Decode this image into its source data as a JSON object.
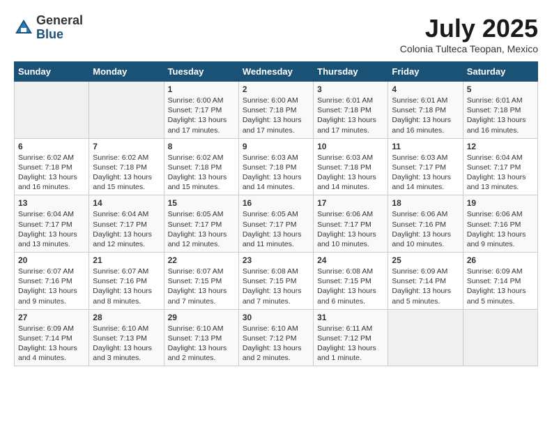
{
  "header": {
    "logo_general": "General",
    "logo_blue": "Blue",
    "month_title": "July 2025",
    "subtitle": "Colonia Tulteca Teopan, Mexico"
  },
  "days_of_week": [
    "Sunday",
    "Monday",
    "Tuesday",
    "Wednesday",
    "Thursday",
    "Friday",
    "Saturday"
  ],
  "weeks": [
    [
      {
        "day": "",
        "info": ""
      },
      {
        "day": "",
        "info": ""
      },
      {
        "day": "1",
        "info": "Sunrise: 6:00 AM\nSunset: 7:17 PM\nDaylight: 13 hours\nand 17 minutes."
      },
      {
        "day": "2",
        "info": "Sunrise: 6:00 AM\nSunset: 7:18 PM\nDaylight: 13 hours\nand 17 minutes."
      },
      {
        "day": "3",
        "info": "Sunrise: 6:01 AM\nSunset: 7:18 PM\nDaylight: 13 hours\nand 17 minutes."
      },
      {
        "day": "4",
        "info": "Sunrise: 6:01 AM\nSunset: 7:18 PM\nDaylight: 13 hours\nand 16 minutes."
      },
      {
        "day": "5",
        "info": "Sunrise: 6:01 AM\nSunset: 7:18 PM\nDaylight: 13 hours\nand 16 minutes."
      }
    ],
    [
      {
        "day": "6",
        "info": "Sunrise: 6:02 AM\nSunset: 7:18 PM\nDaylight: 13 hours\nand 16 minutes."
      },
      {
        "day": "7",
        "info": "Sunrise: 6:02 AM\nSunset: 7:18 PM\nDaylight: 13 hours\nand 15 minutes."
      },
      {
        "day": "8",
        "info": "Sunrise: 6:02 AM\nSunset: 7:18 PM\nDaylight: 13 hours\nand 15 minutes."
      },
      {
        "day": "9",
        "info": "Sunrise: 6:03 AM\nSunset: 7:18 PM\nDaylight: 13 hours\nand 14 minutes."
      },
      {
        "day": "10",
        "info": "Sunrise: 6:03 AM\nSunset: 7:18 PM\nDaylight: 13 hours\nand 14 minutes."
      },
      {
        "day": "11",
        "info": "Sunrise: 6:03 AM\nSunset: 7:17 PM\nDaylight: 13 hours\nand 14 minutes."
      },
      {
        "day": "12",
        "info": "Sunrise: 6:04 AM\nSunset: 7:17 PM\nDaylight: 13 hours\nand 13 minutes."
      }
    ],
    [
      {
        "day": "13",
        "info": "Sunrise: 6:04 AM\nSunset: 7:17 PM\nDaylight: 13 hours\nand 13 minutes."
      },
      {
        "day": "14",
        "info": "Sunrise: 6:04 AM\nSunset: 7:17 PM\nDaylight: 13 hours\nand 12 minutes."
      },
      {
        "day": "15",
        "info": "Sunrise: 6:05 AM\nSunset: 7:17 PM\nDaylight: 13 hours\nand 12 minutes."
      },
      {
        "day": "16",
        "info": "Sunrise: 6:05 AM\nSunset: 7:17 PM\nDaylight: 13 hours\nand 11 minutes."
      },
      {
        "day": "17",
        "info": "Sunrise: 6:06 AM\nSunset: 7:17 PM\nDaylight: 13 hours\nand 10 minutes."
      },
      {
        "day": "18",
        "info": "Sunrise: 6:06 AM\nSunset: 7:16 PM\nDaylight: 13 hours\nand 10 minutes."
      },
      {
        "day": "19",
        "info": "Sunrise: 6:06 AM\nSunset: 7:16 PM\nDaylight: 13 hours\nand 9 minutes."
      }
    ],
    [
      {
        "day": "20",
        "info": "Sunrise: 6:07 AM\nSunset: 7:16 PM\nDaylight: 13 hours\nand 9 minutes."
      },
      {
        "day": "21",
        "info": "Sunrise: 6:07 AM\nSunset: 7:16 PM\nDaylight: 13 hours\nand 8 minutes."
      },
      {
        "day": "22",
        "info": "Sunrise: 6:07 AM\nSunset: 7:15 PM\nDaylight: 13 hours\nand 7 minutes."
      },
      {
        "day": "23",
        "info": "Sunrise: 6:08 AM\nSunset: 7:15 PM\nDaylight: 13 hours\nand 7 minutes."
      },
      {
        "day": "24",
        "info": "Sunrise: 6:08 AM\nSunset: 7:15 PM\nDaylight: 13 hours\nand 6 minutes."
      },
      {
        "day": "25",
        "info": "Sunrise: 6:09 AM\nSunset: 7:14 PM\nDaylight: 13 hours\nand 5 minutes."
      },
      {
        "day": "26",
        "info": "Sunrise: 6:09 AM\nSunset: 7:14 PM\nDaylight: 13 hours\nand 5 minutes."
      }
    ],
    [
      {
        "day": "27",
        "info": "Sunrise: 6:09 AM\nSunset: 7:14 PM\nDaylight: 13 hours\nand 4 minutes."
      },
      {
        "day": "28",
        "info": "Sunrise: 6:10 AM\nSunset: 7:13 PM\nDaylight: 13 hours\nand 3 minutes."
      },
      {
        "day": "29",
        "info": "Sunrise: 6:10 AM\nSunset: 7:13 PM\nDaylight: 13 hours\nand 2 minutes."
      },
      {
        "day": "30",
        "info": "Sunrise: 6:10 AM\nSunset: 7:12 PM\nDaylight: 13 hours\nand 2 minutes."
      },
      {
        "day": "31",
        "info": "Sunrise: 6:11 AM\nSunset: 7:12 PM\nDaylight: 13 hours\nand 1 minute."
      },
      {
        "day": "",
        "info": ""
      },
      {
        "day": "",
        "info": ""
      }
    ]
  ]
}
